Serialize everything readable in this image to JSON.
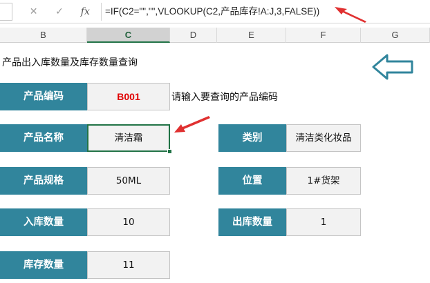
{
  "formula_bar": {
    "cancel_icon": "✕",
    "enter_icon": "✓",
    "fx_label": "fx",
    "formula": "=IF(C2=\"\",\"\",VLOOKUP(C2,产品库存!A:J,3,FALSE))"
  },
  "columns": [
    "B",
    "C",
    "D",
    "E",
    "F",
    "G"
  ],
  "selected_column": "C",
  "sheet": {
    "title": "产品出入库数量及库存数量查询",
    "hint": "请输入要查询的产品编码",
    "rows": [
      {
        "label": "产品编码",
        "value": "B001"
      },
      {
        "label": "产品名称",
        "value": "清洁霜",
        "right_label": "类别",
        "right_value": "清洁类化妆品"
      },
      {
        "label": "产品规格",
        "value": "50ML",
        "right_label": "位置",
        "right_value": "1#货架"
      },
      {
        "label": "入库数量",
        "value": "10",
        "right_label": "出库数量",
        "right_value": "1"
      },
      {
        "label": "库存数量",
        "value": "11"
      }
    ]
  },
  "colors": {
    "label_bg": "#31859c",
    "code_text": "#e00000",
    "selection": "#217346",
    "annotation_arrow": "#e03030",
    "hollow_arrow": "#31859c"
  }
}
